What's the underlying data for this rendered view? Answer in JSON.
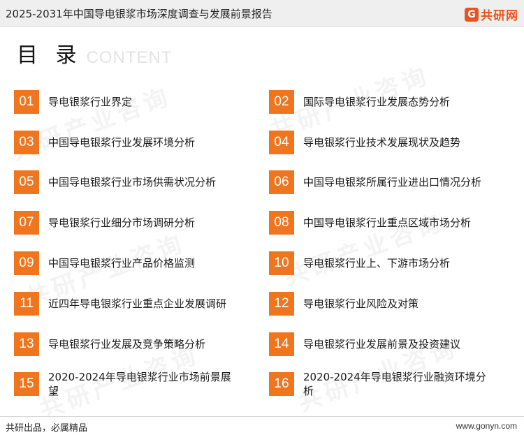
{
  "header": {
    "title": "2025-2031年中国导电银浆市场深度调查与发展前景报告",
    "brand_mark": "G",
    "brand_name": "共研网"
  },
  "heading": {
    "zh": "目 录",
    "en": "CONTENT"
  },
  "watermark_text": "共研产业咨询",
  "watermark_url": "www.gonyn.com",
  "colors": {
    "accent": "#f0751f",
    "brand": "#e8531f"
  },
  "toc": [
    {
      "num": "01",
      "label": "导电银浆行业界定"
    },
    {
      "num": "02",
      "label": "国际导电银浆行业发展态势分析"
    },
    {
      "num": "03",
      "label": "中国导电银浆行业发展环境分析"
    },
    {
      "num": "04",
      "label": "导电银浆行业技术发展现状及趋势"
    },
    {
      "num": "05",
      "label": "中国导电银浆行业市场供需状况分析"
    },
    {
      "num": "06",
      "label": "中国导电银浆所属行业进出口情况分析"
    },
    {
      "num": "07",
      "label": "导电银浆行业细分市场调研分析"
    },
    {
      "num": "08",
      "label": "中国导电银浆行业重点区域市场分析"
    },
    {
      "num": "09",
      "label": "中国导电银浆行业产品价格监测"
    },
    {
      "num": "10",
      "label": "导电银浆行业上、下游市场分析"
    },
    {
      "num": "11",
      "label": "近四年导电银浆行业重点企业发展调研"
    },
    {
      "num": "12",
      "label": "导电银浆行业风险及对策"
    },
    {
      "num": "13",
      "label": "导电银浆行业发展及竞争策略分析"
    },
    {
      "num": "14",
      "label": "导电银浆行业发展前景及投资建议"
    },
    {
      "num": "15",
      "label": "2020-2024年导电银浆行业市场前景展望"
    },
    {
      "num": "16",
      "label": "2020-2024年导电银浆行业融资环境分析"
    }
  ],
  "footer": {
    "slogan": "共研出品，必属精品",
    "url": "www.gonyn.com"
  }
}
